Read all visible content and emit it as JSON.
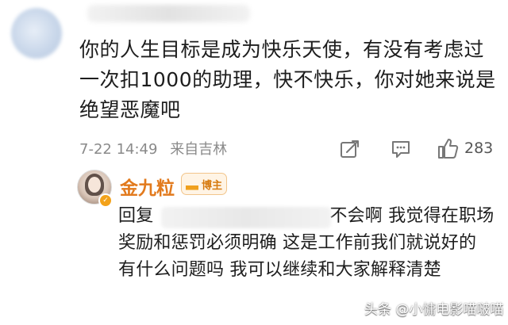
{
  "main_comment": {
    "text": "你的人生目标是成为快乐天使，有没有考虑过一次扣1000的助理，快不快乐，你对她来说是绝望恶魔吧",
    "date": "7-22 14:49",
    "location": "来自吉林",
    "likes": "283"
  },
  "reply": {
    "author": "金九粒",
    "author_badge": "博主",
    "prefix": "回复",
    "text": "不会啊 我觉得在职场 奖励和惩罚必须明确 这是工作前我们就说好的 有什么问题吗 我可以继续和大家解释清楚"
  },
  "watermark": "头条 @小慵电影喵啵喵"
}
